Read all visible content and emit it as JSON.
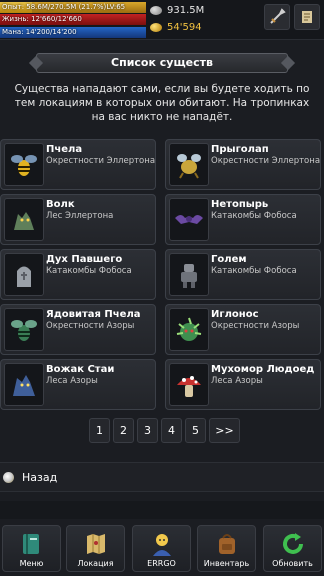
{
  "status": {
    "exp_text": "Опыт: 58.6M/270.5M (21.7%)",
    "exp_fraction": 0.217,
    "level": "LV:65",
    "life_text": "Жизнь: 12'660/12'660",
    "mana_text": "Мана: 14'200/14'200",
    "silver": "931.5M",
    "gold": "54'594",
    "top_icons": [
      "sword-icon",
      "scroll-icon"
    ]
  },
  "title": "Список существ",
  "description": "Существа нападают сами, если вы будете ходить по тем локациям в которых они обитают. На тропинках на вас никто не нападёт.",
  "creatures": [
    {
      "name": "Пчела",
      "location": "Окрестности Эллертона",
      "icon": "bee-icon"
    },
    {
      "name": "Прыголап",
      "location": "Окрестности Эллертона",
      "icon": "jumper-icon"
    },
    {
      "name": "Волк",
      "location": "Лес Эллертона",
      "icon": "wolf-icon"
    },
    {
      "name": "Нетопырь",
      "location": "Катакомбы Фобоса",
      "icon": "bat-icon"
    },
    {
      "name": "Дух Павшего",
      "location": "Катакомбы Фобоса",
      "icon": "tombstone-icon"
    },
    {
      "name": "Голем",
      "location": "Катакомбы Фобоса",
      "icon": "golem-icon"
    },
    {
      "name": "Ядовитая Пчела",
      "location": "Окрестности Азоры",
      "icon": "poison-bee-icon"
    },
    {
      "name": "Иглонос",
      "location": "Окрестности Азоры",
      "icon": "spiky-beast-icon"
    },
    {
      "name": "Вожак Стаи",
      "location": "Леса Азоры",
      "icon": "pack-leader-icon"
    },
    {
      "name": "Мухомор Людоед",
      "location": "Леса Азоры",
      "icon": "mushroom-icon"
    }
  ],
  "pagination": [
    "1",
    "2",
    "3",
    "4",
    "5",
    ">>"
  ],
  "back_label": "Назад",
  "nav": [
    {
      "label": "Меню",
      "icon": "book-icon"
    },
    {
      "label": "Локация",
      "icon": "map-icon"
    },
    {
      "label": "ERRGO",
      "icon": "character-icon"
    },
    {
      "label": "Инвентарь",
      "icon": "backpack-icon"
    },
    {
      "label": "Обновить",
      "icon": "refresh-icon"
    }
  ]
}
